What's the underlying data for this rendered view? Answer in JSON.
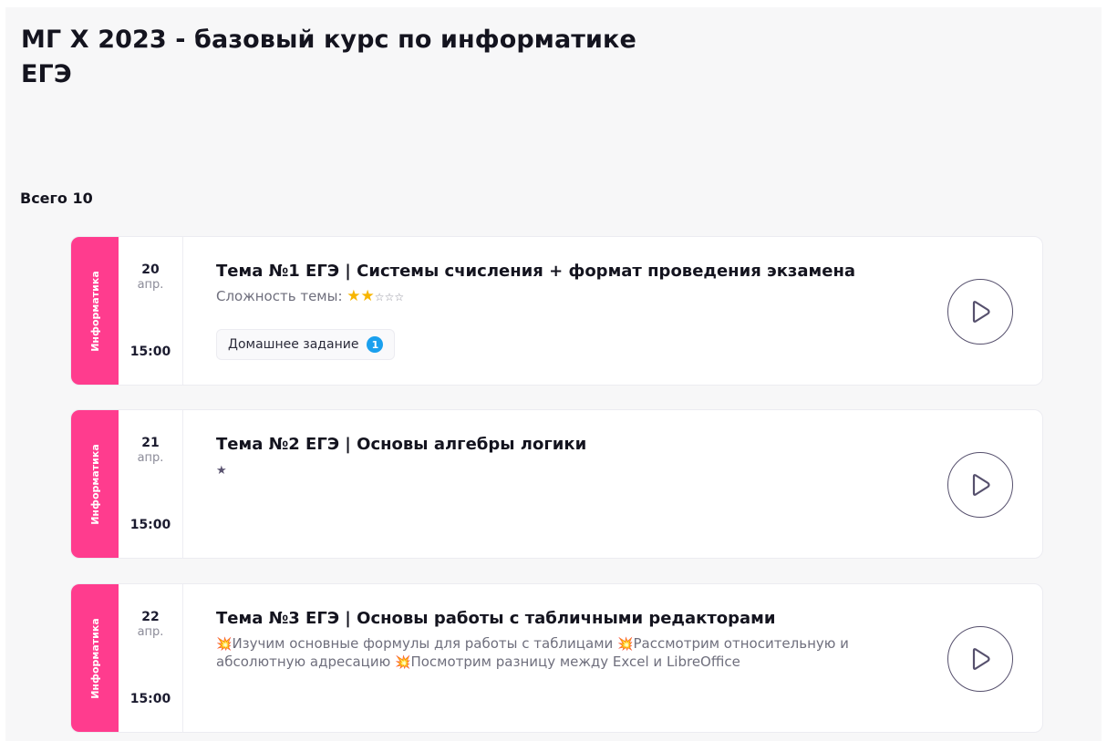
{
  "course": {
    "title": "МГ X 2023 - базовый курс по информатике ЕГЭ"
  },
  "total_label": "Всего 10",
  "colors": {
    "subject_strip": "#ff3c8e",
    "homework_badge": "#1aa0ee",
    "star": "#f7b500"
  },
  "lessons": [
    {
      "subject": "Информатика",
      "day": "20",
      "month": "апр.",
      "time": "15:00",
      "title": "Тема №1 ЕГЭ | Системы счисления + формат проведения экзамена",
      "difficulty_label": "Сложность темы:",
      "difficulty_filled_stars": 2,
      "difficulty_empty_stars": 3,
      "homework_label": "Домашнее задание",
      "homework_count": "1",
      "play_icon": "play-icon"
    },
    {
      "subject": "Информатика",
      "day": "21",
      "month": "апр.",
      "time": "15:00",
      "title": "Тема №2 ЕГЭ | Основы алгебры логики",
      "description": "★",
      "play_icon": "play-icon"
    },
    {
      "subject": "Информатика",
      "day": "22",
      "month": "апр.",
      "time": "15:00",
      "title": "Тема №3 ЕГЭ | Основы работы с табличными редакторами",
      "description_parts": [
        "Изучим основные формулы для работы с таблицами",
        "Рассмотрим относительную и абсолютную адресацию",
        "Посмотрим разницу между Excel и LibreOffice"
      ],
      "description_icon": "collision-emoji-icon",
      "play_icon": "play-icon"
    }
  ]
}
